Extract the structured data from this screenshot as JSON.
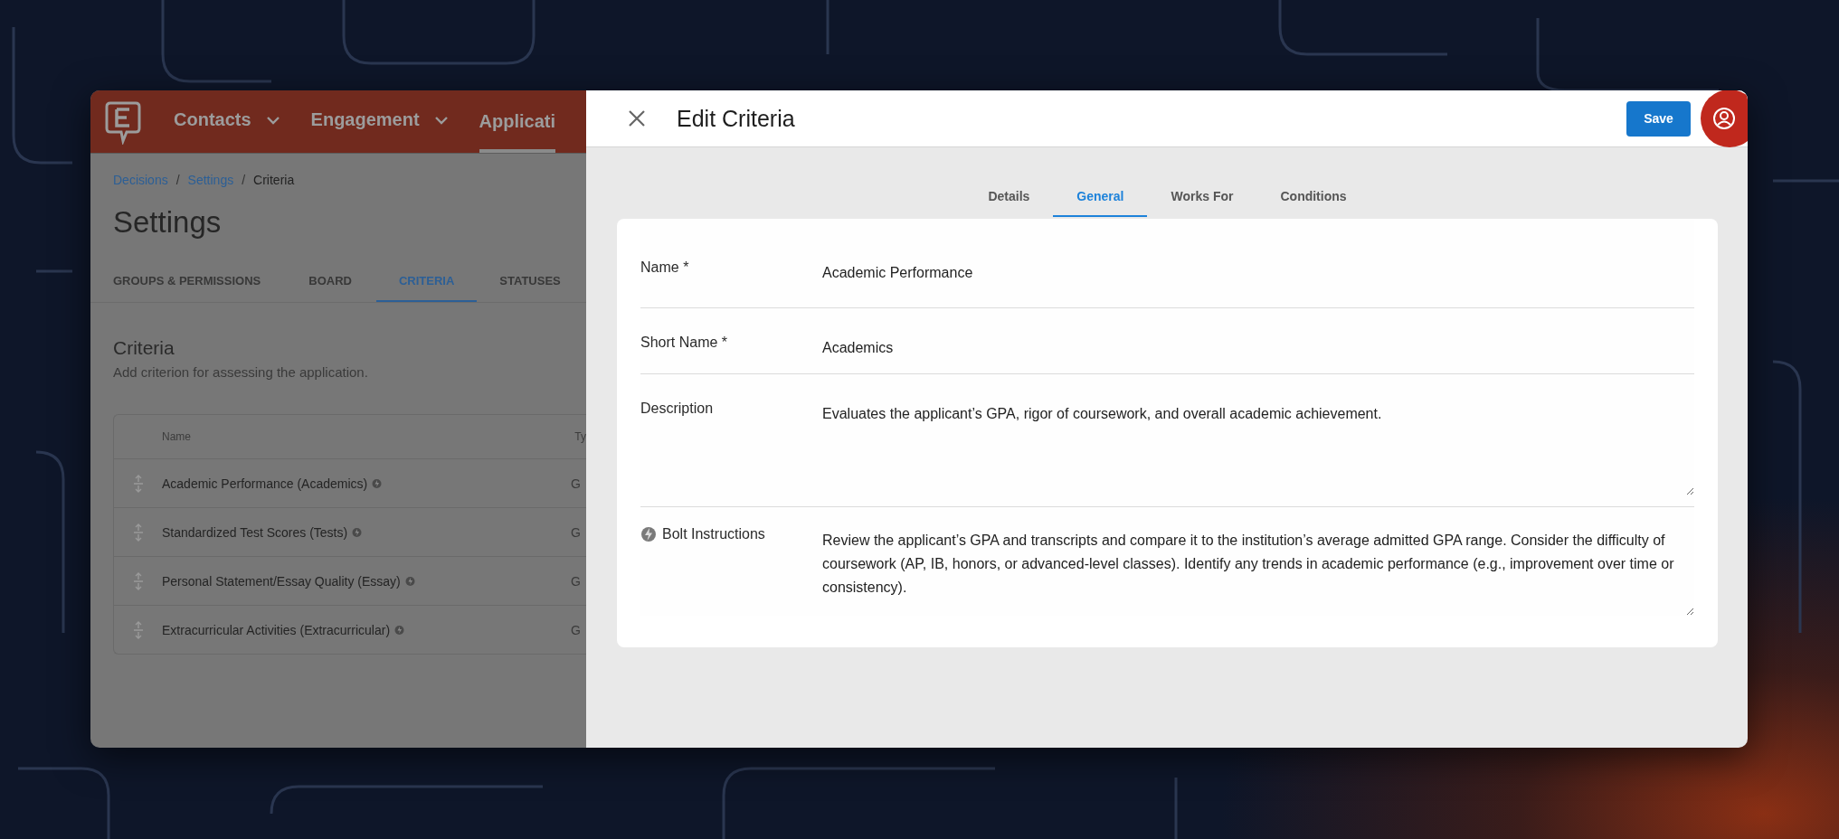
{
  "nav": {
    "items": [
      {
        "label": "Contacts",
        "dropdown": true,
        "selected": false
      },
      {
        "label": "Engagement",
        "dropdown": true,
        "selected": false
      },
      {
        "label": "Applicati",
        "dropdown": false,
        "selected": true
      }
    ]
  },
  "breadcrumb": [
    {
      "label": "Decisions",
      "link": true,
      "separator": "/"
    },
    {
      "label": "Settings",
      "link": true,
      "separator": "/"
    },
    {
      "label": "Criteria",
      "link": false
    }
  ],
  "page_title": "Settings",
  "settings_tabs": [
    {
      "label": "GROUPS & PERMISSIONS",
      "selected": false
    },
    {
      "label": "BOARD",
      "selected": false
    },
    {
      "label": "CRITERIA",
      "selected": true
    },
    {
      "label": "STATUSES",
      "selected": false
    }
  ],
  "section": {
    "title": "Criteria",
    "subtitle": "Add criterion for assessing the application."
  },
  "table": {
    "columns": [
      "Name",
      "Ty"
    ],
    "rows": [
      {
        "name": "Academic Performance (Academics)",
        "bolt": true,
        "column_2": "G"
      },
      {
        "name": "Standardized Test Scores (Tests)",
        "bolt": true,
        "column_2": "G"
      },
      {
        "name": "Personal Statement/Essay Quality (Essay)",
        "bolt": true,
        "column_2": "G"
      },
      {
        "name": "Extracurricular Activities (Extracurricular)",
        "bolt": true,
        "column_2": "G"
      }
    ]
  },
  "drawer": {
    "title": "Edit Criteria",
    "save": "Save",
    "tabs": [
      {
        "label": "Details",
        "selected": false
      },
      {
        "label": "General",
        "selected": true
      },
      {
        "label": "Works For",
        "selected": false
      },
      {
        "label": "Conditions",
        "selected": false
      }
    ],
    "fields": [
      {
        "kind": "input",
        "label": "Name *",
        "value": "Academic Performance",
        "bolt": false
      },
      {
        "kind": "input",
        "label": "Short Name *",
        "value": "Academics",
        "bolt": false
      },
      {
        "kind": "textarea",
        "label": "Description",
        "value": "Evaluates the applicant’s GPA, rigor of coursework, and overall academic achievement.",
        "bolt": false
      },
      {
        "kind": "textarea",
        "label": "Bolt Instructions",
        "value": "Review the applicant’s GPA and transcripts and compare it to the institution’s average admitted GPA range. Consider the difficulty of coursework (AP, IB, honors, or advanced-level classes). Identify any trends in academic performance (e.g., improvement over time or consistency).",
        "bolt": true
      }
    ]
  }
}
